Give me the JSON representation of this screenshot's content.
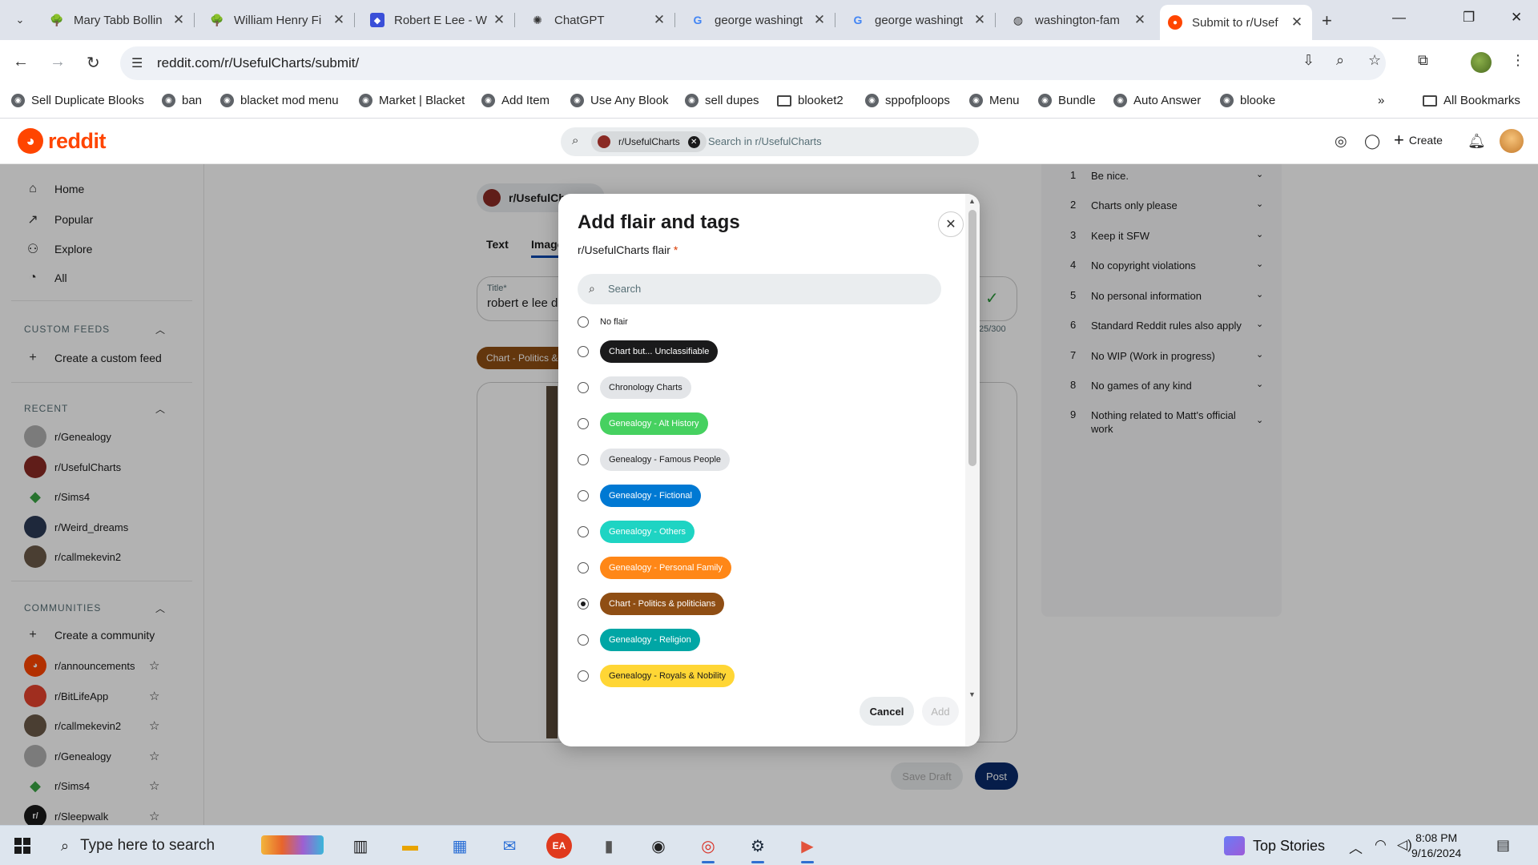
{
  "browser": {
    "tabs": [
      {
        "title": "Mary Tabb Bollin",
        "icon": "tree-icon"
      },
      {
        "title": "William Henry Fi",
        "icon": "tree-icon"
      },
      {
        "title": "Robert E Lee - W",
        "icon": "puzzle-icon"
      },
      {
        "title": "ChatGPT",
        "icon": "chatgpt-icon"
      },
      {
        "title": "george washingt",
        "icon": "google-icon"
      },
      {
        "title": "george washingt",
        "icon": "google-icon"
      },
      {
        "title": "washington-fam",
        "icon": "globe-icon"
      },
      {
        "title": "Submit to r/Usef",
        "icon": "reddit-icon"
      }
    ],
    "url": "reddit.com/r/UsefulCharts/submit/",
    "bookmarks": [
      "Sell Duplicate Blooks",
      "ban",
      "blacket mod menu",
      "Market | Blacket",
      "Add Item",
      "Use Any Blook",
      "sell dupes",
      "blooket2",
      "sppofploops",
      "Menu",
      "Bundle",
      "Auto Answer",
      "blooke"
    ],
    "all_bookmarks": "All Bookmarks"
  },
  "reddit": {
    "logo_text": "reddit",
    "search_chip": "r/UsefulCharts",
    "search_placeholder": "Search in r/UsefulCharts",
    "create_label": "Create"
  },
  "sidebar": {
    "main": [
      "Home",
      "Popular",
      "Explore",
      "All"
    ],
    "custom_feeds_title": "CUSTOM FEEDS",
    "create_custom_feed": "Create a custom feed",
    "recent_title": "RECENT",
    "recent": [
      "r/Genealogy",
      "r/UsefulCharts",
      "r/Sims4",
      "r/Weird_dreams",
      "r/callmekevin2"
    ],
    "communities_title": "COMMUNITIES",
    "create_community": "Create a community",
    "communities": [
      "r/announcements",
      "r/BitLifeApp",
      "r/callmekevin2",
      "r/Genealogy",
      "r/Sims4",
      "r/Sleepwalk"
    ]
  },
  "compose": {
    "subreddit": "r/UsefulCha",
    "tabs": [
      "Text",
      "Image"
    ],
    "title_label": "Title*",
    "title_value": "robert e lee d",
    "char_count": "25/300",
    "flair_chip": "Chart - Politics & p",
    "save_draft": "Save Draft",
    "post": "Post"
  },
  "rules": [
    {
      "n": "1",
      "text": "Be nice."
    },
    {
      "n": "2",
      "text": "Charts only please"
    },
    {
      "n": "3",
      "text": "Keep it SFW"
    },
    {
      "n": "4",
      "text": "No copyright violations"
    },
    {
      "n": "5",
      "text": "No personal information"
    },
    {
      "n": "6",
      "text": "Standard Reddit rules also apply"
    },
    {
      "n": "7",
      "text": "No WIP (Work in progress)"
    },
    {
      "n": "8",
      "text": "No games of any kind"
    },
    {
      "n": "9",
      "text": "Nothing related to Matt's official work"
    }
  ],
  "modal": {
    "title": "Add flair and tags",
    "subtitle": "r/UsefulCharts flair",
    "required_mark": "*",
    "search_placeholder": "Search",
    "no_flair": "No flair",
    "flairs": [
      {
        "label": "Chart but... Unclassifiable",
        "bg": "#1a1a1b",
        "fg": "#ffffff",
        "selected": false
      },
      {
        "label": "Chronology Charts",
        "bg": "#e3e5e8",
        "fg": "#1a1a1b",
        "selected": false
      },
      {
        "label": "Genealogy - Alt History",
        "bg": "#46d160",
        "fg": "#ffffff",
        "selected": false
      },
      {
        "label": "Genealogy - Famous People",
        "bg": "#e3e5e8",
        "fg": "#1a1a1b",
        "selected": false
      },
      {
        "label": "Genealogy - Fictional",
        "bg": "#0079d3",
        "fg": "#ffffff",
        "selected": false
      },
      {
        "label": "Genealogy - Others",
        "bg": "#1ed4c3",
        "fg": "#ffffff",
        "selected": false
      },
      {
        "label": "Genealogy - Personal Family",
        "bg": "#ff8717",
        "fg": "#ffffff",
        "selected": false
      },
      {
        "label": "Chart - Politics & politicians",
        "bg": "#8f4e14",
        "fg": "#ffffff",
        "selected": true
      },
      {
        "label": "Genealogy - Religion",
        "bg": "#00a6a5",
        "fg": "#ffffff",
        "selected": false
      },
      {
        "label": "Genealogy - Royals & Nobility",
        "bg": "#ffd635",
        "fg": "#1a1a1b",
        "selected": false
      }
    ],
    "cancel": "Cancel",
    "add": "Add"
  },
  "taskbar": {
    "search_placeholder": "Type here to search",
    "news": "Top Stories",
    "time": "8:08 PM",
    "date": "9/16/2024"
  }
}
